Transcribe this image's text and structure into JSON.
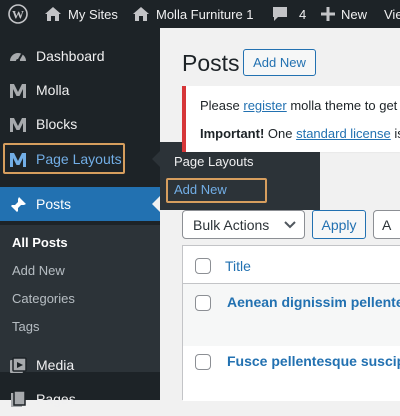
{
  "admin_bar": {
    "my_sites": "My Sites",
    "site_name": "Molla Furniture 1",
    "comments_count": "4",
    "new_label": "New",
    "view_partial": "Vie"
  },
  "sidebar": {
    "items": [
      {
        "label": "Dashboard",
        "icon": "dashboard-icon"
      },
      {
        "label": "Molla",
        "icon": "molla-icon"
      },
      {
        "label": "Blocks",
        "icon": "molla-icon"
      },
      {
        "label": "Page Layouts",
        "icon": "molla-icon"
      },
      {
        "label": "Posts",
        "icon": "pin-icon"
      },
      {
        "label": "Media",
        "icon": "media-icon"
      },
      {
        "label": "Pages",
        "icon": "pages-icon"
      }
    ],
    "submenu": [
      "All Posts",
      "Add New",
      "Categories",
      "Tags"
    ]
  },
  "flyout": {
    "title": "Page Layouts",
    "add_new": "Add New"
  },
  "main": {
    "title": "Posts",
    "add_new_button": "Add New",
    "notice": {
      "line1_prefix": "Please ",
      "line1_link": "register",
      "line1_suffix": " molla theme to get",
      "line2_bold": "Important!",
      "line2_prefix": " One ",
      "line2_link": "standard license",
      "line2_suffix": " is"
    },
    "bulk_actions": "Bulk Actions",
    "apply_button": "Apply",
    "next_select_partial": "A",
    "table": {
      "column_title": "Title",
      "rows": [
        "Aenean dignissim pellentes",
        "Fusce pellentesque suscipit."
      ]
    }
  },
  "colors": {
    "admin_bar_bg": "#1d2327",
    "active_blue": "#2271b1",
    "highlight_orange": "#d69e5e",
    "notice_red": "#d63638"
  }
}
